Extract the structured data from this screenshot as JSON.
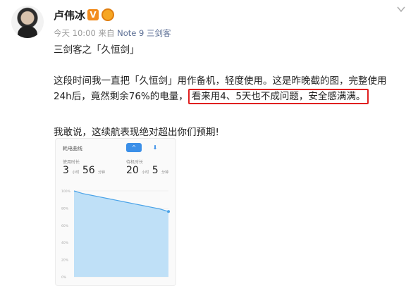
{
  "user": {
    "name": "卢伟冰",
    "verified_badge": "V"
  },
  "meta": {
    "time": "今天 10:00",
    "from": "来自",
    "device": "Note 9 三剑客"
  },
  "post": {
    "line1": "三剑客之「久恒剑」",
    "para2_a": "这段时间我一直把「久恒剑」用作备机，轻度使用。这是昨晚截的图，完整使用24h后，竟然剩余76%的电量，",
    "para2_highlight": "看来用4、5天也不成问题，安全感满满。",
    "line3": "我敢说，这续航表现绝对超出你们预期!"
  },
  "screenshot": {
    "title": "耗电曲线",
    "btn_up": "^",
    "btn_down": "⬇",
    "label_use": "使用时长",
    "label_standby": "待机时长",
    "use_h": "3",
    "use_m": "56",
    "standby_h": "20",
    "standby_m": "5",
    "unit_h": "小时",
    "unit_m": "分钟",
    "y_ticks": [
      "100%",
      "80%",
      "60%",
      "40%",
      "20%",
      "0%"
    ]
  },
  "chart_data": {
    "type": "area",
    "x": [
      0,
      1,
      2,
      3,
      4,
      5,
      6,
      7,
      8,
      9,
      10,
      11
    ],
    "values": [
      100,
      97,
      95,
      93,
      91,
      89,
      87,
      85,
      83,
      81,
      79,
      76
    ],
    "ylim": [
      0,
      100
    ]
  }
}
